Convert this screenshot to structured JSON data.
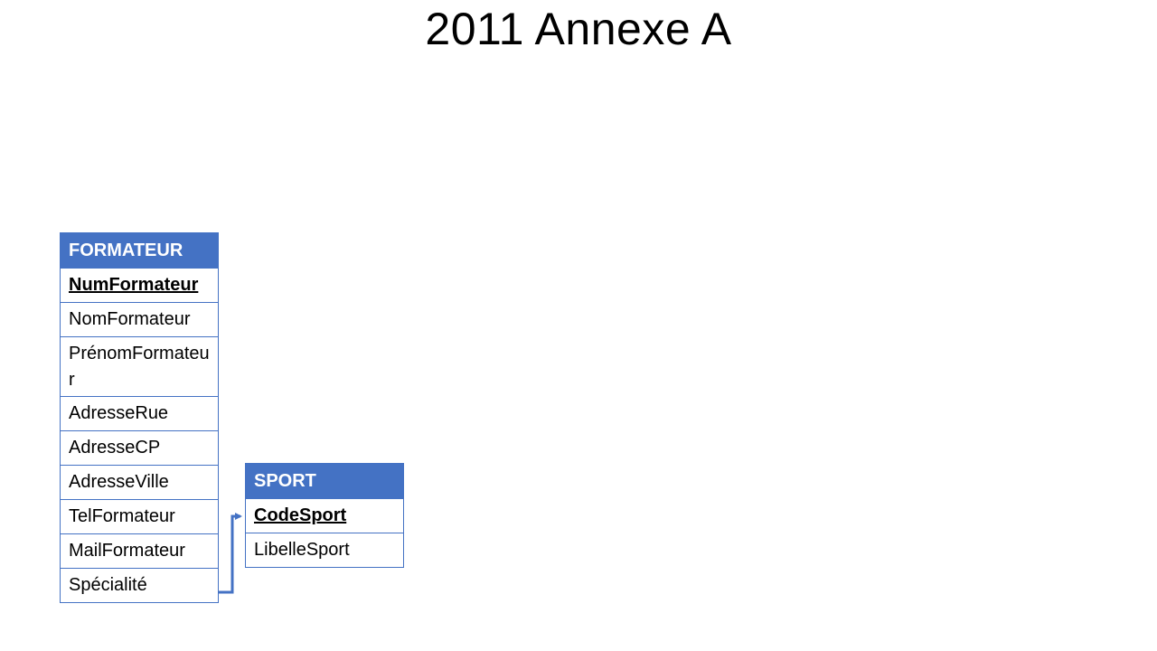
{
  "title": "2011 Annexe A",
  "colors": {
    "accent": "#4472c4",
    "header_text": "#ffffff",
    "link": "#4472c4"
  },
  "entities": [
    {
      "name": "FORMATEUR",
      "fields": [
        {
          "label": "NumFormateur",
          "primary_key": true
        },
        {
          "label": "NomFormateur",
          "primary_key": false
        },
        {
          "label": "PrénomFormateur",
          "primary_key": false
        },
        {
          "label": "AdresseRue",
          "primary_key": false
        },
        {
          "label": "AdresseCP",
          "primary_key": false
        },
        {
          "label": "AdresseVille",
          "primary_key": false
        },
        {
          "label": "TelFormateur",
          "primary_key": false
        },
        {
          "label": "MailFormateur",
          "primary_key": false
        },
        {
          "label": "Spécialité",
          "primary_key": false
        }
      ]
    },
    {
      "name": "SPORT",
      "fields": [
        {
          "label": "CodeSport",
          "primary_key": true
        },
        {
          "label": "LibelleSport",
          "primary_key": false
        }
      ]
    }
  ],
  "relations": [
    {
      "from_entity": "FORMATEUR",
      "from_field": "Spécialité",
      "to_entity": "SPORT",
      "to_field": "CodeSport"
    }
  ]
}
